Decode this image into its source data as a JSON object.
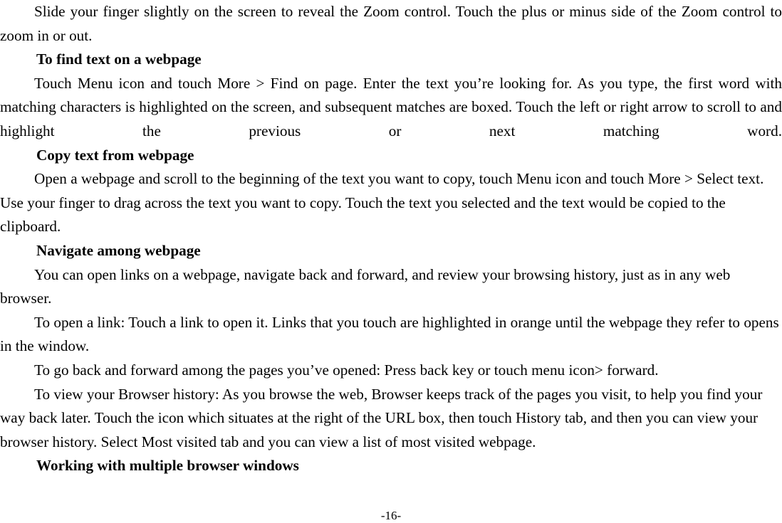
{
  "document": {
    "page_number_label": "-16-",
    "blocks": [
      {
        "type": "paragraph",
        "style": "justify",
        "text": "Slide your finger slightly on the screen to reveal the Zoom control. Touch the plus or minus side of the Zoom control to zoom in or out."
      },
      {
        "type": "heading",
        "text": "To find text on a webpage"
      },
      {
        "type": "paragraph",
        "style": "justify-all",
        "text": "Touch Menu icon and touch More > Find on page. Enter the text you’re looking for. As you type, the first word with matching characters is highlighted on the screen, and subsequent matches are boxed. Touch the left or right arrow to scroll to and highlight the previous or next matching word."
      },
      {
        "type": "heading",
        "text": "Copy text from webpage"
      },
      {
        "type": "paragraph",
        "style": "plain",
        "text": "Open a webpage and scroll to the beginning of the text you want to copy, touch Menu icon and touch More > Select text. Use your finger to drag across the text you want to copy. Touch the text you selected and the text would be copied to the clipboard."
      },
      {
        "type": "heading",
        "text": "Navigate among webpage"
      },
      {
        "type": "paragraph",
        "style": "plain",
        "text": "You can open links on a webpage, navigate back and forward, and review your browsing history, just as in any web browser."
      },
      {
        "type": "paragraph",
        "style": "plain",
        "text": "To open a link: Touch a link to open it. Links that you touch are highlighted in orange until the webpage they refer to opens in the window."
      },
      {
        "type": "paragraph",
        "style": "plain",
        "text": "To go back and forward among the pages you’ve opened: Press back key or touch menu icon> forward."
      },
      {
        "type": "paragraph",
        "style": "plain",
        "text": "To view your Browser history: As you browse the web, Browser keeps track of the pages you visit, to help you find your way back later. Touch the icon which situates at the right of the URL box, then touch History tab, and then you can view your browser history. Select Most visited tab and you can view a list of most visited webpage."
      },
      {
        "type": "heading",
        "text": "Working with multiple browser windows"
      }
    ]
  }
}
